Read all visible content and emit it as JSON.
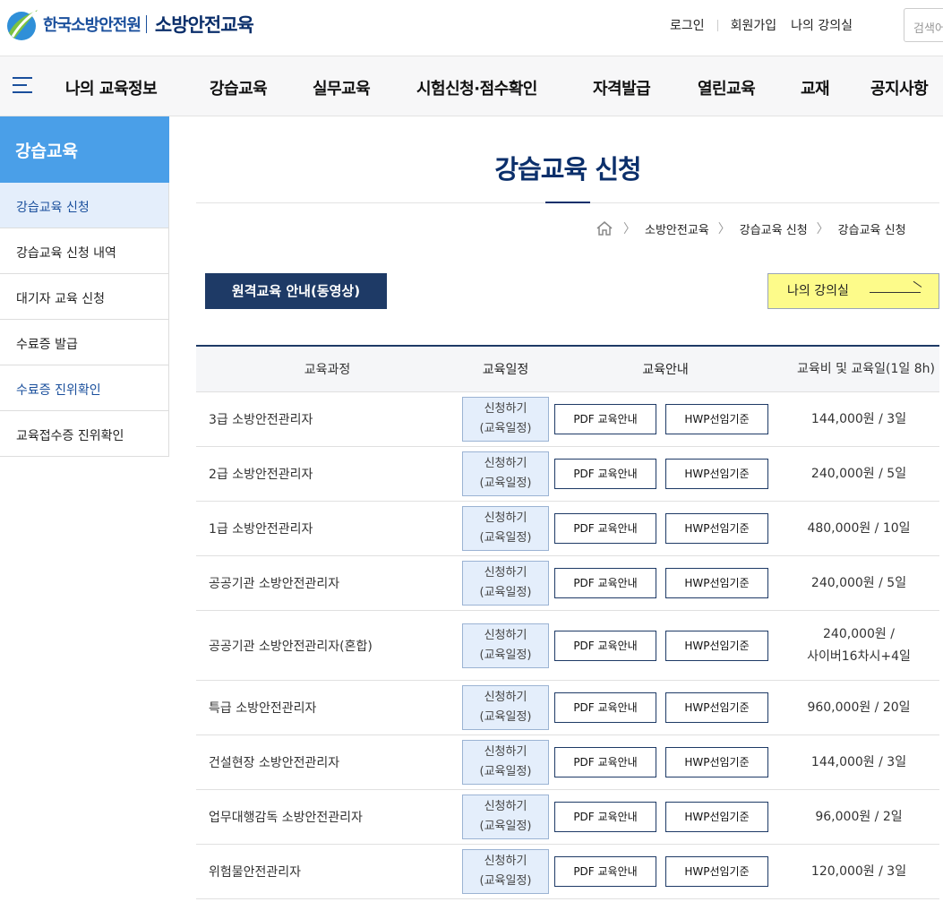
{
  "header": {
    "org_name": "한국소방안전원",
    "site_name": "소방안전교육",
    "login": "로그인",
    "signup": "회원가입",
    "my_classroom": "나의 강의실",
    "search_placeholder": "검색어"
  },
  "gnb": {
    "items": [
      "나의 교육정보",
      "강습교육",
      "실무교육",
      "시험신청·점수확인",
      "자격발급",
      "열린교육",
      "교재",
      "공지사항"
    ]
  },
  "sidebar": {
    "title": "강습교육",
    "items": [
      "강습교육 신청",
      "강습교육 신청 내역",
      "대기자 교육 신청",
      "수료증 발급",
      "수료증 진위확인",
      "교육접수증 진위확인"
    ]
  },
  "page": {
    "title": "강습교육 신청",
    "breadcrumb": [
      "소방안전교육",
      "강습교육 신청",
      "강습교육 신청"
    ],
    "video_button": "원격교육 안내(동영상)",
    "classroom_button": "나의 강의실"
  },
  "table": {
    "headers": [
      "교육과정",
      "교육일정",
      "교육안내",
      "교육비 및 교육일(1일 8h)"
    ],
    "apply_line1": "신청하기",
    "apply_line2": "(교육일정)",
    "pdf_label": "PDF 교육안내",
    "hwp_label": "HWP선임기준",
    "rows": [
      {
        "course": "3급 소방안전관리자",
        "fee_line1": "144,000원 / 3일",
        "fee_line2": ""
      },
      {
        "course": "2급 소방안전관리자",
        "fee_line1": "240,000원 / 5일",
        "fee_line2": ""
      },
      {
        "course": "1급 소방안전관리자",
        "fee_line1": "480,000원 / 10일",
        "fee_line2": ""
      },
      {
        "course": "공공기관 소방안전관리자",
        "fee_line1": "240,000원 / 5일",
        "fee_line2": ""
      },
      {
        "course": "공공기관 소방안전관리자(혼합)",
        "fee_line1": "240,000원 /",
        "fee_line2": "사이버16차시+4일"
      },
      {
        "course": "특급 소방안전관리자",
        "fee_line1": "960,000원 / 20일",
        "fee_line2": ""
      },
      {
        "course": "건설현장 소방안전관리자",
        "fee_line1": "144,000원 / 3일",
        "fee_line2": ""
      },
      {
        "course": "업무대행감독 소방안전관리자",
        "fee_line1": "96,000원 / 2일",
        "fee_line2": ""
      },
      {
        "course": "위험물안전관리자",
        "fee_line1": "120,000원 / 3일",
        "fee_line2": ""
      }
    ]
  },
  "colors": {
    "brand_navy": "#0b2f6b",
    "lnb_blue": "#4a9fe8",
    "classroom_yellow": "#fdfb8a"
  }
}
